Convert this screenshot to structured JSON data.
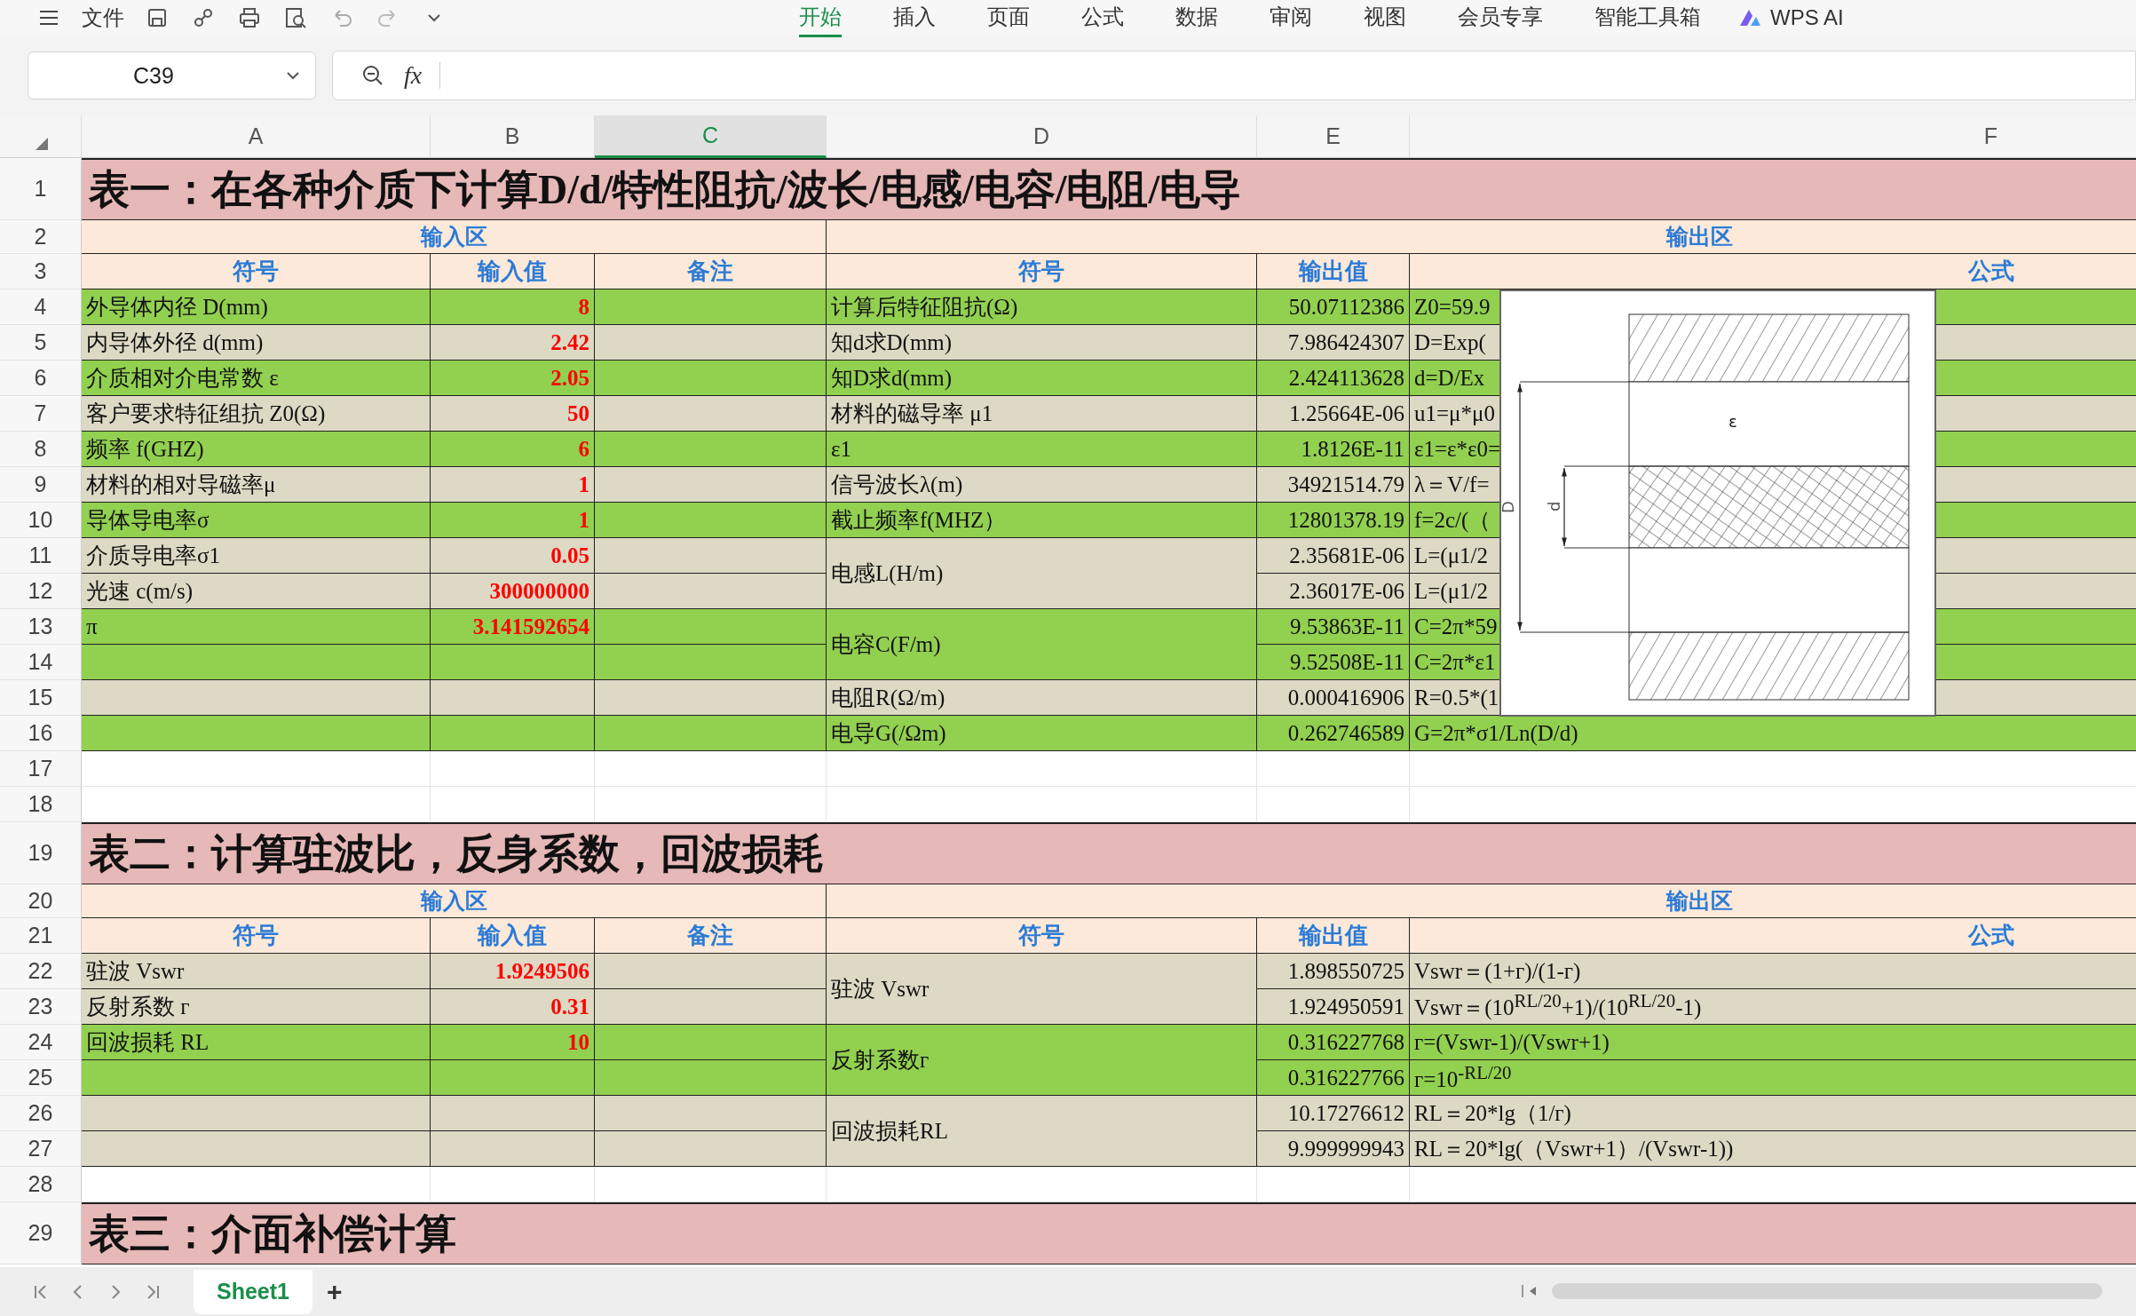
{
  "menu_bar": {
    "file_label": "文件",
    "tabs": [
      {
        "label": "开始",
        "selected": true
      },
      {
        "label": "插入",
        "selected": false
      },
      {
        "label": "页面",
        "selected": false
      },
      {
        "label": "公式",
        "selected": false
      },
      {
        "label": "数据",
        "selected": false
      },
      {
        "label": "审阅",
        "selected": false
      },
      {
        "label": "视图",
        "selected": false
      },
      {
        "label": "会员专享",
        "selected": false
      },
      {
        "label": "智能工具箱",
        "selected": false
      }
    ],
    "ai_label": "WPS AI"
  },
  "formula_bar": {
    "cell_reference": "C39",
    "function_label": "fx"
  },
  "column_headers": [
    {
      "label": "A",
      "selected": false
    },
    {
      "label": "B",
      "selected": false
    },
    {
      "label": "C",
      "selected": true
    },
    {
      "label": "D",
      "selected": false
    },
    {
      "label": "E",
      "selected": false
    },
    {
      "label": "F",
      "selected": false
    }
  ],
  "row_numbers": [
    "1",
    "2",
    "3",
    "4",
    "5",
    "6",
    "7",
    "8",
    "9",
    "10",
    "11",
    "12",
    "13",
    "14",
    "15",
    "16",
    "17",
    "18",
    "19",
    "20",
    "21",
    "22",
    "23",
    "24",
    "25",
    "26",
    "27",
    "28",
    "29"
  ],
  "tables": [
    {
      "title": "表一：在各种介质下计算D/d/特性阻抗/波长/电感/电容/电阻/电导",
      "input_header": "输入区",
      "output_header": "输出区",
      "input_headings": [
        "符号",
        "输入值",
        "备注"
      ],
      "output_headings": [
        "符号",
        "输出值",
        "公式"
      ],
      "input_rows": [
        {
          "symbol": "外导体内径 D(mm)",
          "value": "8",
          "color": "#92d050"
        },
        {
          "symbol": "内导体外径 d(mm)",
          "value": "2.42",
          "color": "#ddd9c4"
        },
        {
          "symbol": "介质相对介电常数 ε",
          "value": "2.05",
          "color": "#92d050"
        },
        {
          "symbol": "客户要求特征组抗 Z0(Ω)",
          "value": "50",
          "color": "#ddd9c4"
        },
        {
          "symbol": "频率 f(GHZ)",
          "value": "6",
          "color": "#92d050"
        },
        {
          "symbol": "材料的相对导磁率μ",
          "value": "1",
          "color": "#ddd9c4"
        },
        {
          "symbol": "导体导电率σ",
          "value": "1",
          "color": "#92d050"
        },
        {
          "symbol": "介质导电率σ1",
          "value": "0.05",
          "color": "#ddd9c4"
        },
        {
          "symbol": "光速 c(m/s)",
          "value": "300000000",
          "color": "#ddd9c4"
        },
        {
          "symbol": "π",
          "value": "3.141592654",
          "color": "#92d050"
        },
        {
          "color": "#92d050"
        },
        {
          "color": "#ddd9c4"
        },
        {
          "color": "#92d050"
        }
      ],
      "output_groups": [
        {
          "symbol": "计算后特征阻抗(Ω)",
          "color": "#92d050",
          "rows": [
            {
              "value": "50.07112386",
              "formula": "Z0=59.9"
            }
          ]
        },
        {
          "symbol": "知d求D(mm)",
          "color": "#ddd9c4",
          "rows": [
            {
              "value": "7.986424307",
              "formula": "D=Exp("
            }
          ]
        },
        {
          "symbol": "知D求d(mm)",
          "color": "#92d050",
          "rows": [
            {
              "value": "2.424113628",
              "formula": "d=D/Ex"
            }
          ]
        },
        {
          "symbol": "材料的磁导率 μ1",
          "color": "#ddd9c4",
          "rows": [
            {
              "value": "1.25664E-06",
              "formula": "u1=μ*μ0"
            }
          ]
        },
        {
          "symbol": "ε1",
          "color": "#92d050",
          "rows": [
            {
              "value": "1.8126E-11",
              "formula": "ε1=ε*ε0="
            }
          ]
        },
        {
          "symbol": "信号波长λ(m)",
          "color": "#ddd9c4",
          "rows": [
            {
              "value": "34921514.79",
              "formula": "λ＝V/f="
            }
          ]
        },
        {
          "symbol": "截止频率f(MHZ）",
          "color": "#92d050",
          "rows": [
            {
              "value": "12801378.19",
              "formula": "f=2c/(（"
            }
          ]
        },
        {
          "symbol": "电感L(H/m)",
          "color": "#ddd9c4",
          "rows": [
            {
              "value": "2.35681E-06",
              "formula": "L=(μ1/2"
            },
            {
              "value": "2.36017E-06",
              "formula": "L=(μ1/2"
            }
          ]
        },
        {
          "symbol": "电容C(F/m)",
          "color": "#92d050",
          "rows": [
            {
              "value": "9.53863E-11",
              "formula": "C=2π*59"
            },
            {
              "value": "9.52508E-11",
              "formula": "C=2π*ε1"
            }
          ]
        },
        {
          "symbol": "电阻R(Ω/m)",
          "color": "#ddd9c4",
          "rows": [
            {
              "value": "0.000416906",
              "formula": "R=0.5*(1"
            }
          ]
        },
        {
          "symbol": "电导G(/Ωm)",
          "color": "#92d050",
          "rows": [
            {
              "value": "0.262746589",
              "formula": "G=2π*σ1/Ln(D/d)"
            }
          ]
        }
      ]
    },
    {
      "title": "表二：计算驻波比，反身系数，回波损耗",
      "input_header": "输入区",
      "output_header": "输出区",
      "input_headings": [
        "符号",
        "输入值",
        "备注"
      ],
      "output_headings": [
        "符号",
        "输出值",
        "公式"
      ],
      "input_rows": [
        {
          "symbol": "驻波 Vswr",
          "value": "1.9249506",
          "color": "#ddd9c4"
        },
        {
          "symbol": "反射系数 г",
          "value": "0.31",
          "color": "#ddd9c4"
        },
        {
          "symbol": "回波损耗 RL",
          "value": "10",
          "color": "#92d050"
        },
        {
          "color": "#92d050"
        },
        {
          "color": "#ddd9c4"
        },
        {
          "color": "#ddd9c4"
        }
      ],
      "output_groups": [
        {
          "symbol": "驻波 Vswr",
          "color": "#ddd9c4",
          "rows": [
            {
              "value": "1.898550725",
              "formula": "Vswr＝(1+г)/(1-г)"
            },
            {
              "value": "1.924950591",
              "formula": "Vswr＝(10$^{RL/20}$+1)/(10$^{RL/20}$-1)"
            }
          ]
        },
        {
          "symbol": "反射系数г",
          "color": "#92d050",
          "rows": [
            {
              "value": "0.316227768",
              "formula": "г=(Vswr-1)/(Vswr+1)"
            },
            {
              "value": "0.316227766",
              "formula": "г=10$^{-RL/20}$"
            }
          ]
        },
        {
          "symbol": "回波损耗RL",
          "color": "#ddd9c4",
          "rows": [
            {
              "value": "10.17276612",
              "formula": "RL＝20*lg（1/г)"
            },
            {
              "value": "9.999999943",
              "formula": "RL＝20*lg(（Vswr+1）/(Vswr-1))"
            }
          ]
        }
      ]
    },
    {
      "title": "表三：介面补偿计算"
    }
  ],
  "diagram": {
    "dielectric_label": "ε",
    "outer_label": "D",
    "inner_label": "d"
  },
  "sheet_tabs": [
    {
      "label": "Sheet1",
      "selected": true
    }
  ],
  "add_sheet": "+"
}
